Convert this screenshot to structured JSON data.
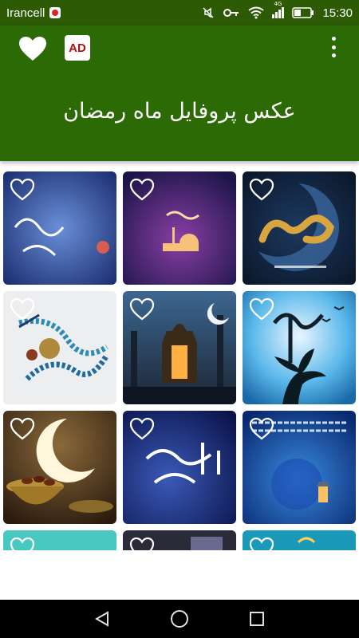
{
  "status_bar": {
    "carrier": "Irancell",
    "network": "4G",
    "time": "15:30"
  },
  "header": {
    "title": "عکس پروفایل ماه رمضان",
    "ad_label": "AD"
  },
  "colors": {
    "header_bg": "#2c6a05",
    "status_bg": "#2c5a05"
  },
  "grid": {
    "tiles": [
      {
        "icon": "heart-outline-icon"
      },
      {
        "icon": "heart-outline-icon"
      },
      {
        "icon": "heart-outline-icon"
      },
      {
        "icon": "heart-outline-icon"
      },
      {
        "icon": "heart-outline-icon"
      },
      {
        "icon": "heart-outline-icon"
      },
      {
        "icon": "heart-outline-icon"
      },
      {
        "icon": "heart-outline-icon"
      },
      {
        "icon": "heart-outline-icon"
      },
      {
        "icon": "heart-outline-icon"
      },
      {
        "icon": "heart-outline-icon"
      },
      {
        "icon": "heart-outline-icon"
      }
    ]
  },
  "nav_bar": {
    "back_icon": "back-triangle-icon",
    "home_icon": "home-circle-icon",
    "recents_icon": "recents-square-icon"
  }
}
